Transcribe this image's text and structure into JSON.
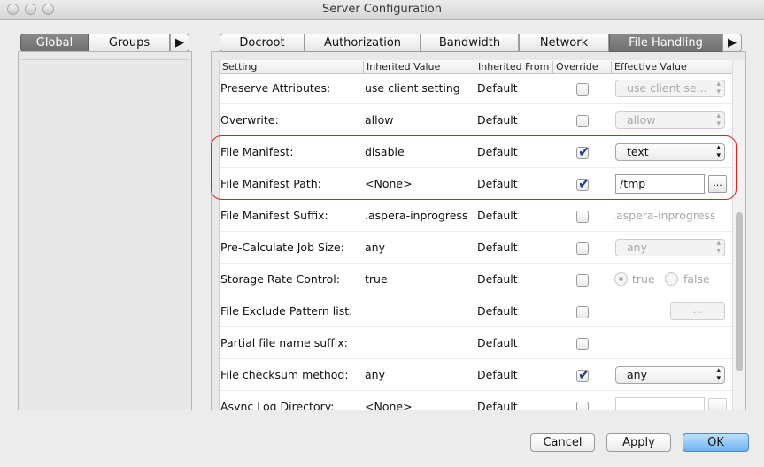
{
  "window": {
    "title": "Server Configuration"
  },
  "left_tabs": [
    "Global",
    "Groups",
    "▶"
  ],
  "right_tabs": [
    "Docroot",
    "Authorization",
    "Bandwidth",
    "Network",
    "File Handling",
    "▶"
  ],
  "table": {
    "headers": [
      "Setting",
      "Inherited Value",
      "Inherited From",
      "Override",
      "Effective Value"
    ],
    "rows": [
      {
        "setting": "Preserve Attributes:",
        "inherited": "use client setting",
        "from": "Default",
        "override": false,
        "effective": "use client se..."
      },
      {
        "setting": "Overwrite:",
        "inherited": "allow",
        "from": "Default",
        "override": false,
        "effective": "allow"
      },
      {
        "setting": "File Manifest:",
        "inherited": "disable",
        "from": "Default",
        "override": true,
        "effective": "text"
      },
      {
        "setting": "File Manifest Path:",
        "inherited": "<None>",
        "from": "Default",
        "override": true,
        "effective": "/tmp",
        "browse": "..."
      },
      {
        "setting": "File Manifest Suffix:",
        "inherited": ".aspera-inprogress",
        "from": "Default",
        "override": false,
        "effective": ".aspera-inprogress"
      },
      {
        "setting": "Pre-Calculate Job Size:",
        "inherited": "any",
        "from": "Default",
        "override": false,
        "effective": "any"
      },
      {
        "setting": "Storage Rate Control:",
        "inherited": "true",
        "from": "Default",
        "override": false,
        "radio_true": "true",
        "radio_false": "false"
      },
      {
        "setting": "File Exclude Pattern list:",
        "inherited": "",
        "from": "Default",
        "override": false,
        "browse": "..."
      },
      {
        "setting": "Partial file name suffix:",
        "inherited": "",
        "from": "Default",
        "override": false
      },
      {
        "setting": "File checksum method:",
        "inherited": "any",
        "from": "Default",
        "override": true,
        "effective": "any"
      },
      {
        "setting": "Async Log Directory:",
        "inherited": "<None>",
        "from": "Default",
        "override": false
      }
    ]
  },
  "buttons": {
    "cancel": "Cancel",
    "apply": "Apply",
    "ok": "OK"
  },
  "colors": {
    "highlight": "#e02020",
    "selected_tab": "#7a7a7a",
    "primary_button": "#6cb3f2"
  }
}
